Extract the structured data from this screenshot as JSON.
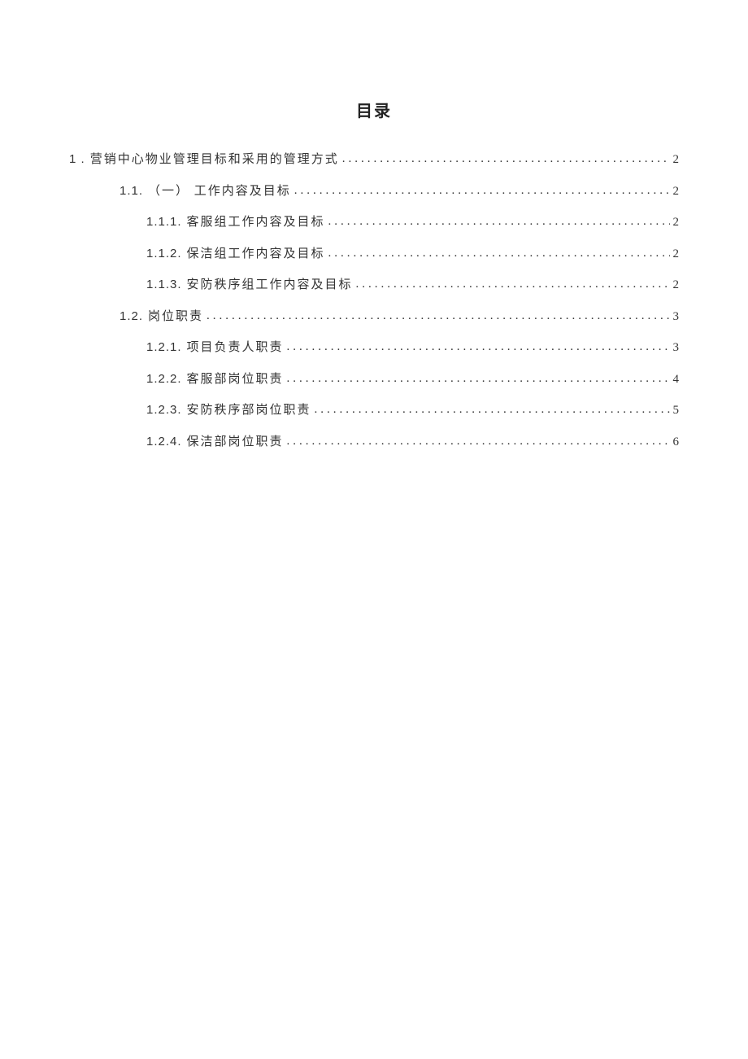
{
  "title": "目录",
  "entries": [
    {
      "level": 1,
      "number": "1 .",
      "text": "营销中心物业管理目标和采用的管理方式",
      "page": "2"
    },
    {
      "level": 2,
      "number": "1.1.",
      "text": "（一）  工作内容及目标",
      "page": "2"
    },
    {
      "level": 3,
      "number": "1.1.1.",
      "text": "客服组工作内容及目标",
      "page": "2"
    },
    {
      "level": 3,
      "number": "1.1.2.",
      "text": "保洁组工作内容及目标",
      "page": "2"
    },
    {
      "level": 3,
      "number": "1.1.3.",
      "text": "安防秩序组工作内容及目标",
      "page": "2"
    },
    {
      "level": 2,
      "number": "1.2.",
      "text": "岗位职责",
      "page": "3"
    },
    {
      "level": 3,
      "number": "1.2.1.",
      "text": "项目负责人职责",
      "page": "3"
    },
    {
      "level": 3,
      "number": "1.2.2.",
      "text": "客服部岗位职责",
      "page": "4"
    },
    {
      "level": 3,
      "number": "1.2.3.",
      "text": "安防秩序部岗位职责",
      "page": "5"
    },
    {
      "level": 3,
      "number": "1.2.4.",
      "text": "保洁部岗位职责",
      "page": "6"
    }
  ]
}
